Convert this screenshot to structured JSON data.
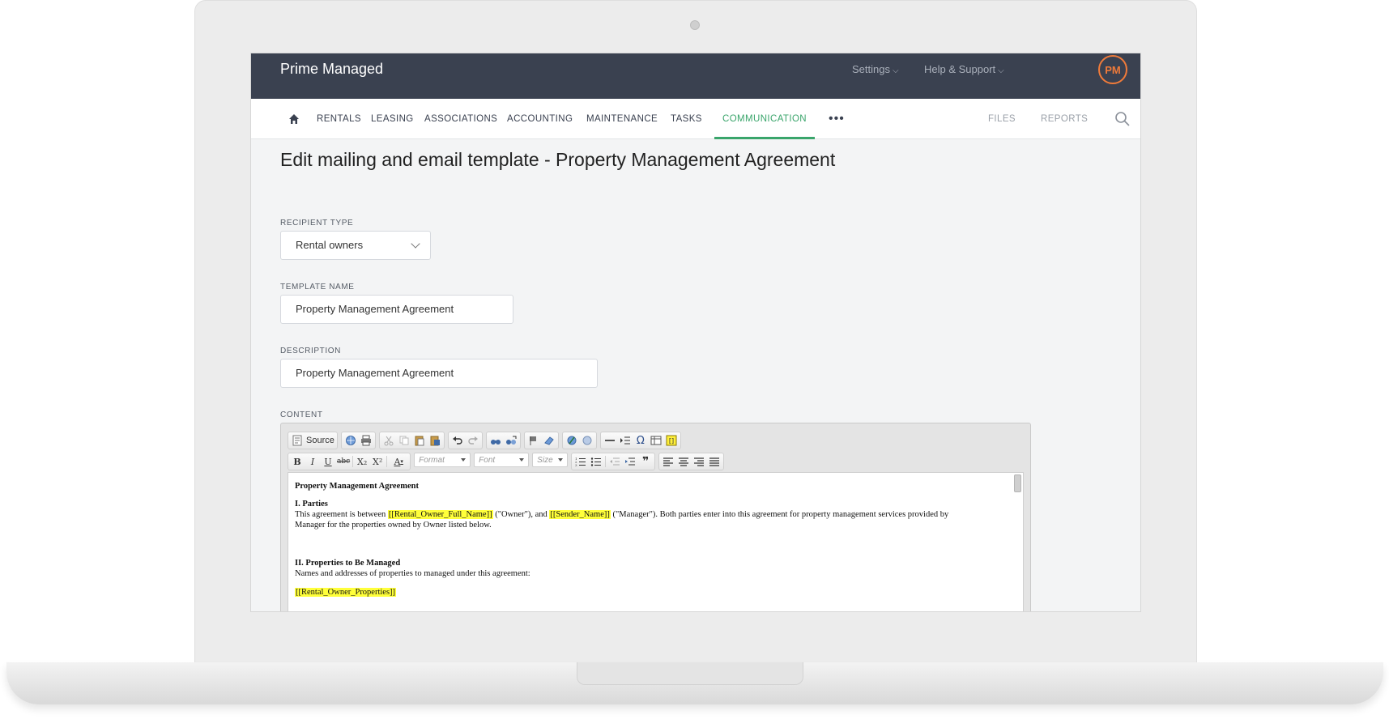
{
  "header": {
    "brand": "Prime Managed",
    "settings_label": "Settings",
    "help_label": "Help & Support",
    "avatar_initials": "PM",
    "accent_color": "#f07b3a"
  },
  "nav": {
    "home_icon": "home-icon",
    "items": [
      {
        "label": "RENTALS"
      },
      {
        "label": "LEASING"
      },
      {
        "label": "ASSOCIATIONS"
      },
      {
        "label": "ACCOUNTING"
      },
      {
        "label": "MAINTENANCE"
      },
      {
        "label": "TASKS"
      },
      {
        "label": "COMMUNICATION"
      }
    ],
    "more_label": "•••",
    "files_label": "FILES",
    "reports_label": "REPORTS",
    "active_color": "#3aa56b"
  },
  "page": {
    "title": "Edit mailing and email template - Property Management Agreement"
  },
  "form": {
    "recipient_type_label": "RECIPIENT TYPE",
    "recipient_type_value": "Rental owners",
    "template_name_label": "TEMPLATE NAME",
    "template_name_value": "Property Management Agreement",
    "description_label": "DESCRIPTION",
    "description_value": "Property Management Agreement",
    "content_label": "CONTENT"
  },
  "editor": {
    "source_label": "Source",
    "format_placeholder": "Format",
    "font_placeholder": "Font",
    "size_placeholder": "Size",
    "bold_label": "B",
    "italic_label": "I",
    "underline_label": "U",
    "strike_label": "abc",
    "subscript_label": "X₂",
    "superscript_label": "X²",
    "text_color_label": "A",
    "doc": {
      "heading": "Property Management Agreement",
      "section1_title": "I. Parties",
      "section1_text_a": "This agreement is between ",
      "merge_owner": "[[Rental_Owner_Full_Name]]",
      "section1_text_b": " (\"Owner\"), and ",
      "merge_sender": "[[Sender_Name]]",
      "section1_text_c": " (\"Manager\"). Both parties enter into this agreement for property management services provided by",
      "section1_text_d": "Manager for the properties owned by Owner listed below.",
      "section2_title": "II. Properties to Be Managed",
      "section2_text": "Names and addresses of properties to managed under this agreement:",
      "merge_properties": "[[Rental_Owner_Properties]]"
    },
    "highlight_color": "#ffff3a"
  }
}
